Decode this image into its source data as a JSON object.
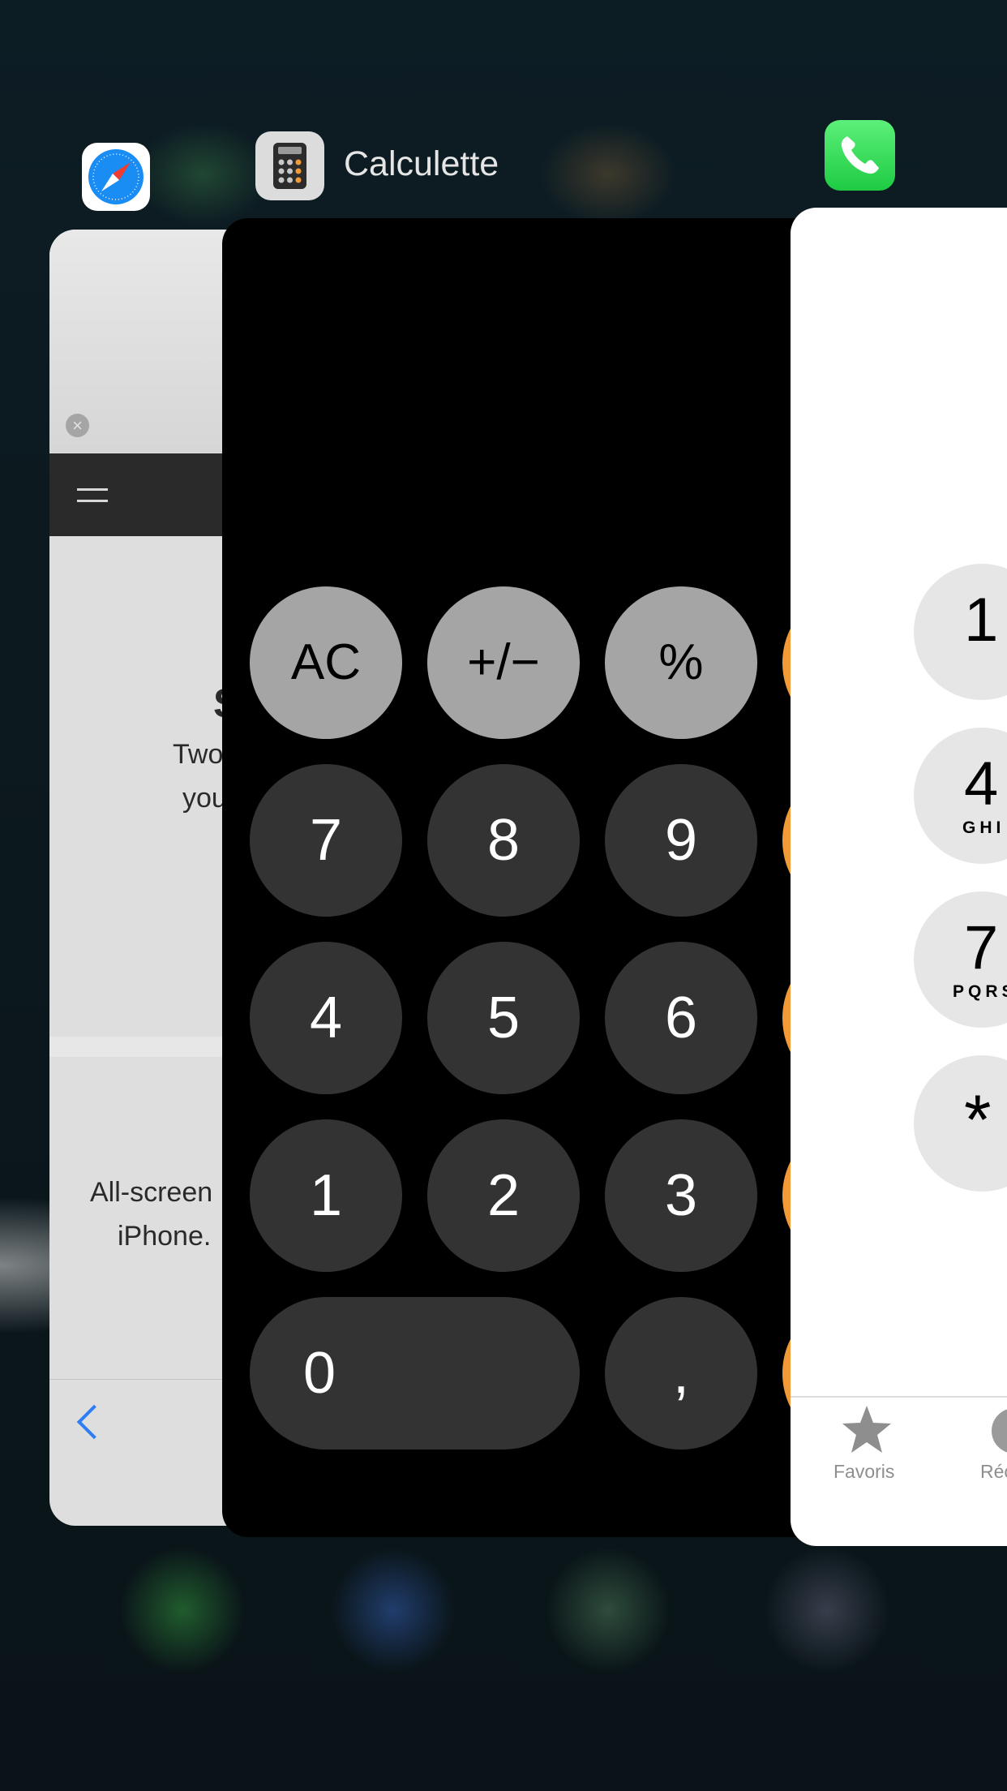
{
  "switcher": {
    "active_app_title": "Calculette"
  },
  "safari": {
    "text_line1": "Two",
    "text_line2": "you",
    "text_line3": "All-screen",
    "text_line4": "iPhone.",
    "heading_fragment": "S",
    "accent_color": "#2e7cf6"
  },
  "calculator": {
    "keys": {
      "ac": "AC",
      "sign": "+/−",
      "percent": "%",
      "k7": "7",
      "k8": "8",
      "k9": "9",
      "k4": "4",
      "k5": "5",
      "k6": "6",
      "k1": "1",
      "k2": "2",
      "k3": "3",
      "k0": "0",
      "comma": ","
    },
    "operator_color": "#f19a37"
  },
  "phone": {
    "keys": {
      "k1": "1",
      "k4": "4",
      "k4_letters": "GHI",
      "k7": "7",
      "k7_letters": "PQRS",
      "star": "*"
    },
    "tabs": {
      "favorites": "Favoris",
      "recents": "Réc"
    }
  }
}
